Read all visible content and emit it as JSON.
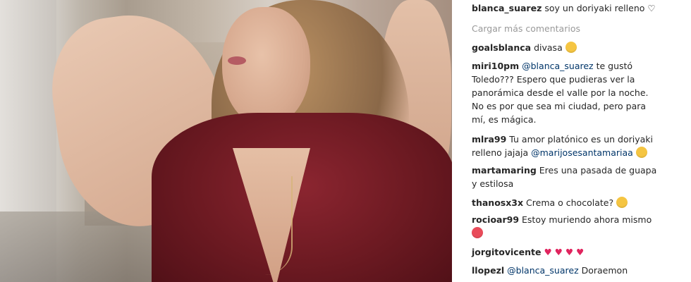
{
  "caption": {
    "user": "blanca_suarez",
    "text": "soy un doriyaki relleno ♡"
  },
  "load_more": "Cargar más comentarios",
  "comments": [
    {
      "user": "goalsblanca",
      "text": "divasa"
    },
    {
      "user": "miri10pm",
      "mention": "@blanca_suarez",
      "text_1": "te gustó",
      "text_2": "Toledo??? Espero que pudieras ver la",
      "text_3": "panorámica desde el valle por la noche.",
      "text_4": "No es por que sea mi ciudad, pero para",
      "text_5": "mí, es mágica."
    },
    {
      "user": "mlra99",
      "text_1": "Tu amor platónico es un doriyaki",
      "text_2": "relleno jajaja",
      "mention": "@marijosesantamariaa"
    },
    {
      "user": "martamaring",
      "text_1": "Eres una pasada de guapa",
      "text_2": "y estilosa"
    },
    {
      "user": "thanosx3x",
      "text": "Crema o chocolate?"
    },
    {
      "user": "rocioar99",
      "text": "Estoy muriendo ahora mismo"
    },
    {
      "user": "jorgitovicente",
      "text": "♥ ♥ ♥ ♥"
    },
    {
      "user": "llopezl",
      "mention": "@blanca_suarez",
      "text": "Doraemon"
    }
  ],
  "emoji_icon": "emoji-icon"
}
